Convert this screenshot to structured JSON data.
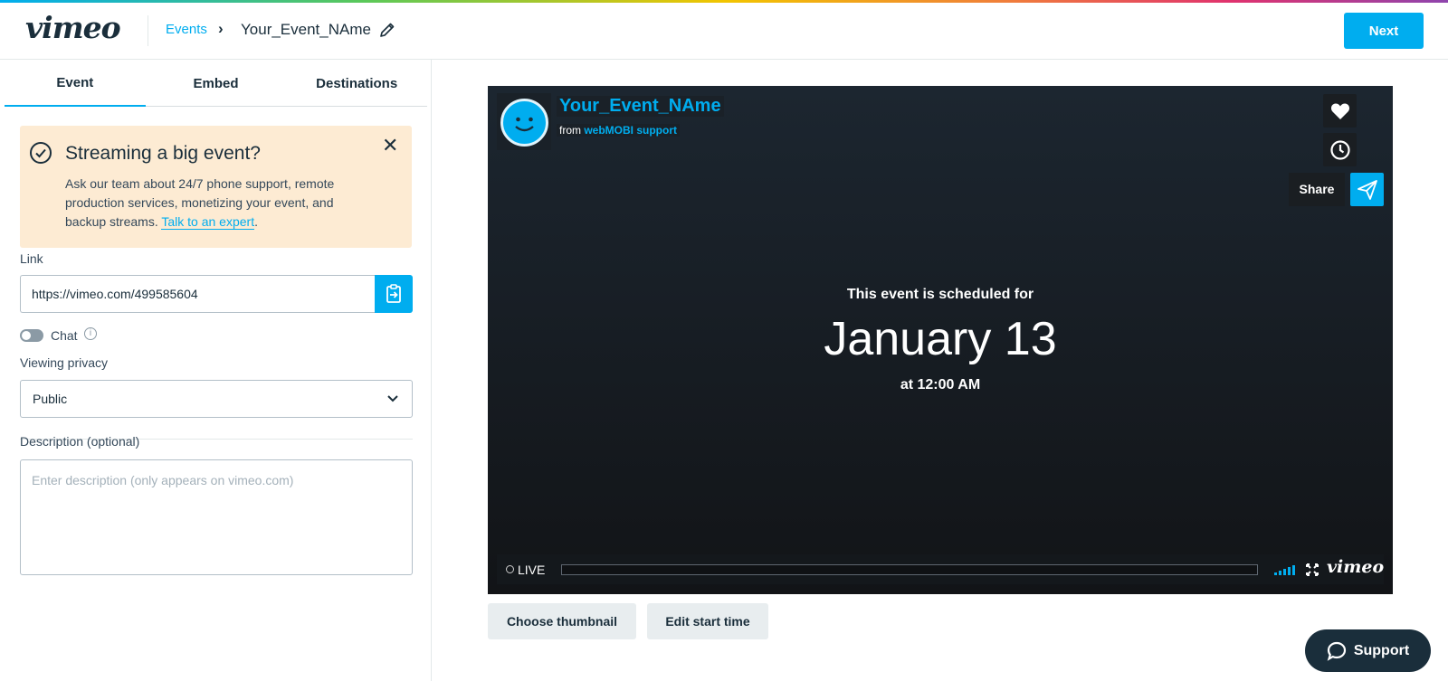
{
  "header": {
    "logo": "vimeo",
    "breadcrumb_events": "Events",
    "breadcrumb_sep": "›",
    "event_name": "Your_Event_NAme",
    "next_label": "Next"
  },
  "tabs": [
    {
      "label": "Event",
      "active": true
    },
    {
      "label": "Embed",
      "active": false
    },
    {
      "label": "Destinations",
      "active": false
    }
  ],
  "promo": {
    "title": "Streaming a big event?",
    "body": "Ask our team about 24/7 phone support, remote production services, monetizing your event, and backup streams.",
    "link": "Talk to an expert",
    "trailing": "."
  },
  "link_field": {
    "label": "Link",
    "value": "https://vimeo.com/499585604"
  },
  "chat": {
    "label": "Chat",
    "enabled": false
  },
  "privacy": {
    "label": "Viewing privacy",
    "value": "Public"
  },
  "description": {
    "label": "Description (optional)",
    "placeholder": "Enter description (only appears on vimeo.com)"
  },
  "player": {
    "title": "Your_Event_NAme",
    "from_prefix": "from",
    "user": "webMOBI support",
    "share_label": "Share",
    "scheduled_label": "This event is scheduled for",
    "date": "January 13",
    "time": "at 12:00 AM",
    "live_label": "LIVE",
    "logo": "vimeo"
  },
  "buttons": {
    "choose_thumbnail": "Choose thumbnail",
    "edit_start_time": "Edit start time",
    "support": "Support"
  },
  "colors": {
    "accent": "#00adef",
    "dark": "#1a2e3b",
    "promo_bg": "#fdebd3"
  }
}
